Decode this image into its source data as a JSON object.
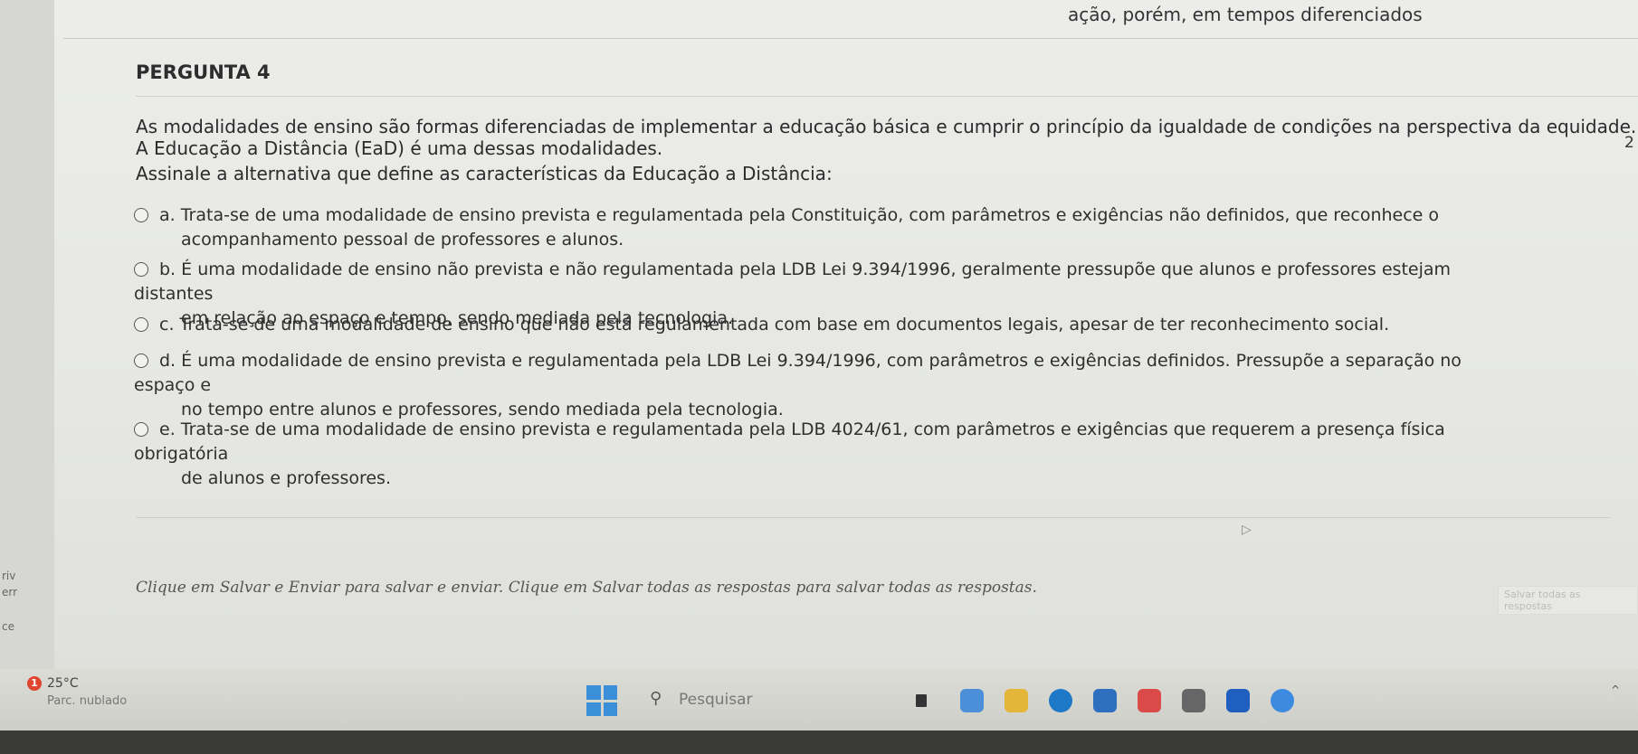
{
  "top_snippet": "ação, porém, em tempos diferenciados",
  "question": {
    "title": "PERGUNTA 4",
    "number_side": "2",
    "stem_lines": [
      "As modalidades de ensino são formas diferenciadas de implementar a educação básica e cumprir o princípio da igualdade de condições na perspectiva da equidade.",
      "A Educação a Distância (EaD) é uma dessas modalidades.",
      "Assinale a alternativa que define as características da Educação a Distância:"
    ],
    "options": [
      {
        "letter": "a.",
        "line1": "Trata-se de uma modalidade de ensino prevista e regulamentada pela Constituição, com parâmetros e exigências não definidos, que reconhece o",
        "line2": "acompanhamento pessoal de professores e alunos."
      },
      {
        "letter": "b.",
        "line1": "É uma modalidade de ensino não prevista e não regulamentada pela LDB Lei 9.394/1996, geralmente pressupõe que alunos e professores estejam distantes",
        "line2": "em relação ao espaço e tempo, sendo mediada pela tecnologia."
      },
      {
        "letter": "c.",
        "line1": "Trata-se de uma modalidade de ensino que não está regulamentada com base em documentos legais, apesar de ter reconhecimento social.",
        "line2": ""
      },
      {
        "letter": "d.",
        "line1": "É uma modalidade de ensino prevista e regulamentada pela LDB Lei 9.394/1996, com parâmetros e exigências definidos. Pressupõe a separação no espaço e",
        "line2": "no tempo entre alunos e professores, sendo mediada pela tecnologia."
      },
      {
        "letter": "e.",
        "line1": "Trata-se de uma modalidade de ensino prevista e regulamentada pela LDB 4024/61, com parâmetros e exigências que requerem a presença física obrigatória",
        "line2": "de  alunos e professores."
      }
    ]
  },
  "footer": {
    "note": "Clique em Salvar e Enviar para salvar e enviar. Clique em Salvar todas as respostas para salvar todas as respostas.",
    "save_all_label": "Salvar todas as respostas"
  },
  "left_strip": [
    "riv",
    "err",
    "ce"
  ],
  "taskbar": {
    "weather_badge": "1",
    "weather_temp": "25°C",
    "weather_desc": "Parc. nublado",
    "search_placeholder": "Pesquisar",
    "pinned_icons": [
      "file-explorer-icon",
      "photos-icon",
      "folder-icon",
      "edge-icon",
      "store-icon",
      "chrome-icon",
      "video-icon",
      "dropbox-icon",
      "chrome-alt-icon"
    ],
    "pinned_colors": [
      "#333333",
      "#4a8fd8",
      "#e3b63a",
      "#1e78c8",
      "#2f6fbf",
      "#d94a48",
      "#666666",
      "#1f5fbf",
      "#3d8be0"
    ]
  }
}
